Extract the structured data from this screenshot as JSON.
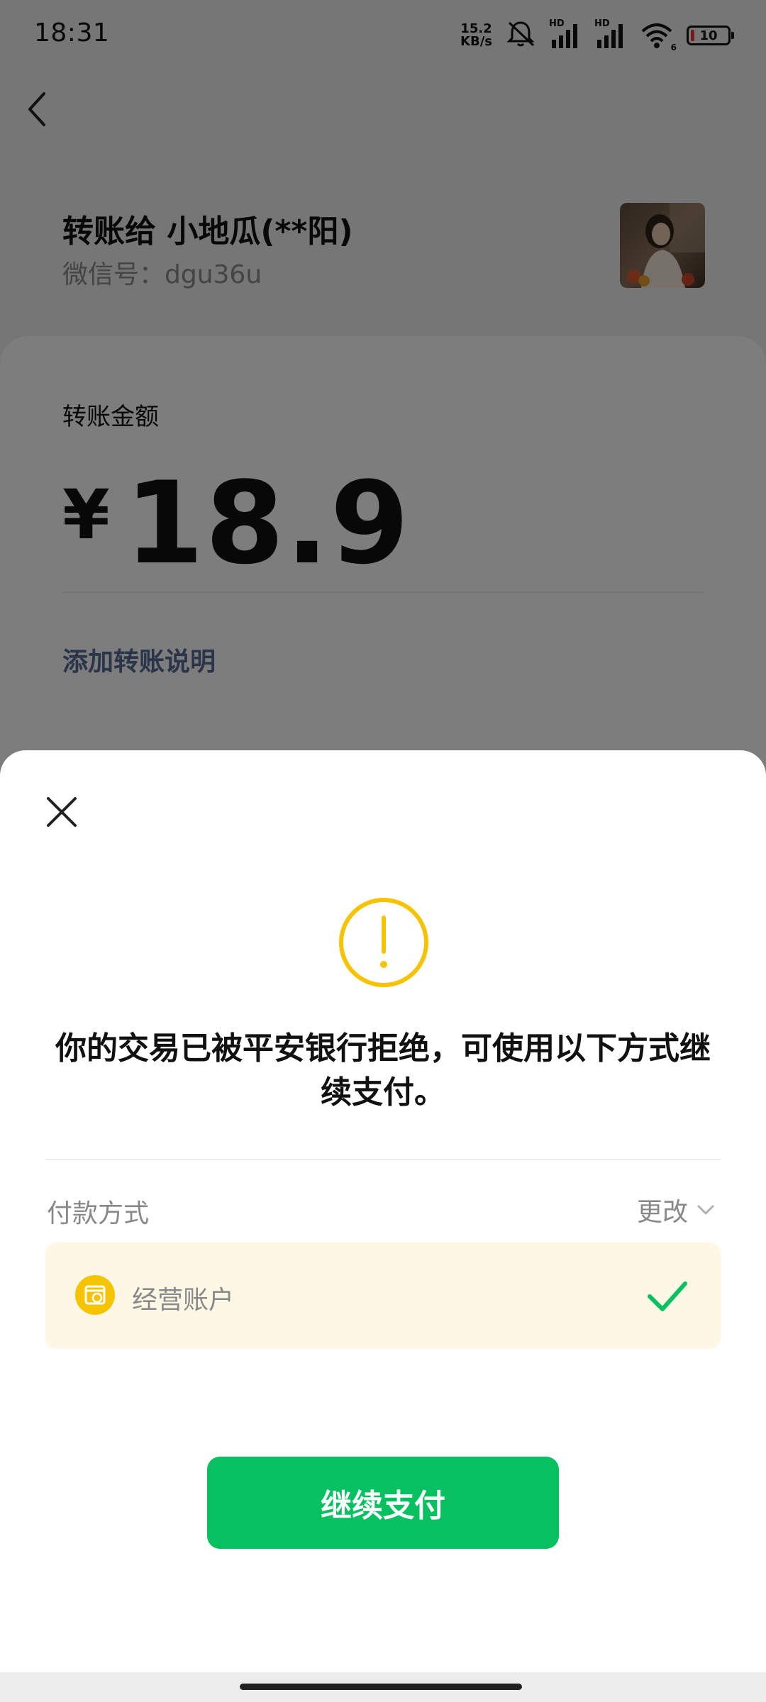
{
  "status_bar": {
    "time": "18:31",
    "net_speed_value": "15.2",
    "net_speed_unit": "KB/s",
    "battery_level": "10",
    "signal_label_1": "HD",
    "signal_label_2": "HD",
    "wifi_label": "6",
    "battery_fill_color": "#e53935"
  },
  "header": {
    "back_icon": "chevron-left-icon"
  },
  "recipient": {
    "title": "转账给 小地瓜(**阳)",
    "wechat_id": "微信号：dgu36u"
  },
  "amount": {
    "label": "转账金额",
    "currency": "¥",
    "value": "18.9",
    "add_note": "添加转账说明"
  },
  "dialog": {
    "close_icon": "close-icon",
    "warning_icon": "exclamation-circle-icon",
    "warning_color": "#f5c300",
    "message": "你的交易已被平安银行拒绝，可使用以下方式继续支付。",
    "payment_method_label": "付款方式",
    "change_label": "更改",
    "option": {
      "label": "经营账户",
      "icon": "store-icon",
      "selected": true,
      "check_color": "#07c160"
    },
    "continue_button": "继续支付",
    "accent_color": "#07c160"
  }
}
